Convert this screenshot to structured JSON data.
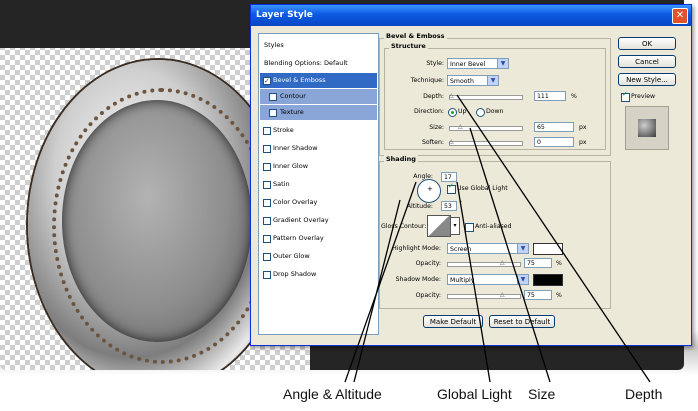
{
  "dialog": {
    "title": "Layer Style",
    "close_glyph": "✕"
  },
  "styles_list": {
    "items": [
      {
        "label": "Styles",
        "type": "head"
      },
      {
        "label": "Blending Options: Default",
        "type": "head"
      },
      {
        "label": "Bevel & Emboss",
        "type": "sel",
        "checked": true
      },
      {
        "label": "Contour",
        "type": "sub"
      },
      {
        "label": "Texture",
        "type": "sub"
      },
      {
        "label": "Stroke"
      },
      {
        "label": "Inner Shadow"
      },
      {
        "label": "Inner Glow"
      },
      {
        "label": "Satin"
      },
      {
        "label": "Color Overlay"
      },
      {
        "label": "Gradient Overlay"
      },
      {
        "label": "Pattern Overlay"
      },
      {
        "label": "Outer Glow"
      },
      {
        "label": "Drop Shadow"
      }
    ]
  },
  "bevel": {
    "group_title": "Bevel & Emboss",
    "structure_title": "Structure",
    "style_label": "Style:",
    "style_value": "Inner Bevel",
    "technique_label": "Technique:",
    "technique_value": "Smooth",
    "depth_label": "Depth:",
    "depth_value": "111",
    "depth_unit": "%",
    "direction_label": "Direction:",
    "direction_up": "Up",
    "direction_down": "Down",
    "size_label": "Size:",
    "size_value": "65",
    "size_unit": "px",
    "soften_label": "Soften:",
    "soften_value": "0",
    "soften_unit": "px"
  },
  "shading": {
    "title": "Shading",
    "angle_label": "Angle:",
    "angle_value": "17",
    "global_light_label": "Use Global Light",
    "altitude_label": "Altitude:",
    "altitude_value": "53",
    "altitude_unit": "°",
    "gloss_label": "Gloss Contour:",
    "anti_aliased_label": "Anti-aliased",
    "highlight_mode_label": "Highlight Mode:",
    "highlight_mode_value": "Screen",
    "highlight_opacity_label": "Opacity:",
    "highlight_opacity_value": "75",
    "highlight_opacity_unit": "%",
    "shadow_mode_label": "Shadow Mode:",
    "shadow_mode_value": "Multiply",
    "shadow_opacity_label": "Opacity:",
    "shadow_opacity_value": "75",
    "shadow_opacity_unit": "%",
    "highlight_color": "#ffffff",
    "shadow_color": "#000000"
  },
  "buttons": {
    "make_default": "Make Default",
    "reset_default": "Reset to Default",
    "ok": "OK",
    "cancel": "Cancel",
    "new_style": "New Style...",
    "preview": "Preview"
  },
  "annotations": {
    "angle_altitude": "Angle & Altitude",
    "global_light": "Global Light",
    "size": "Size",
    "depth": "Depth"
  }
}
